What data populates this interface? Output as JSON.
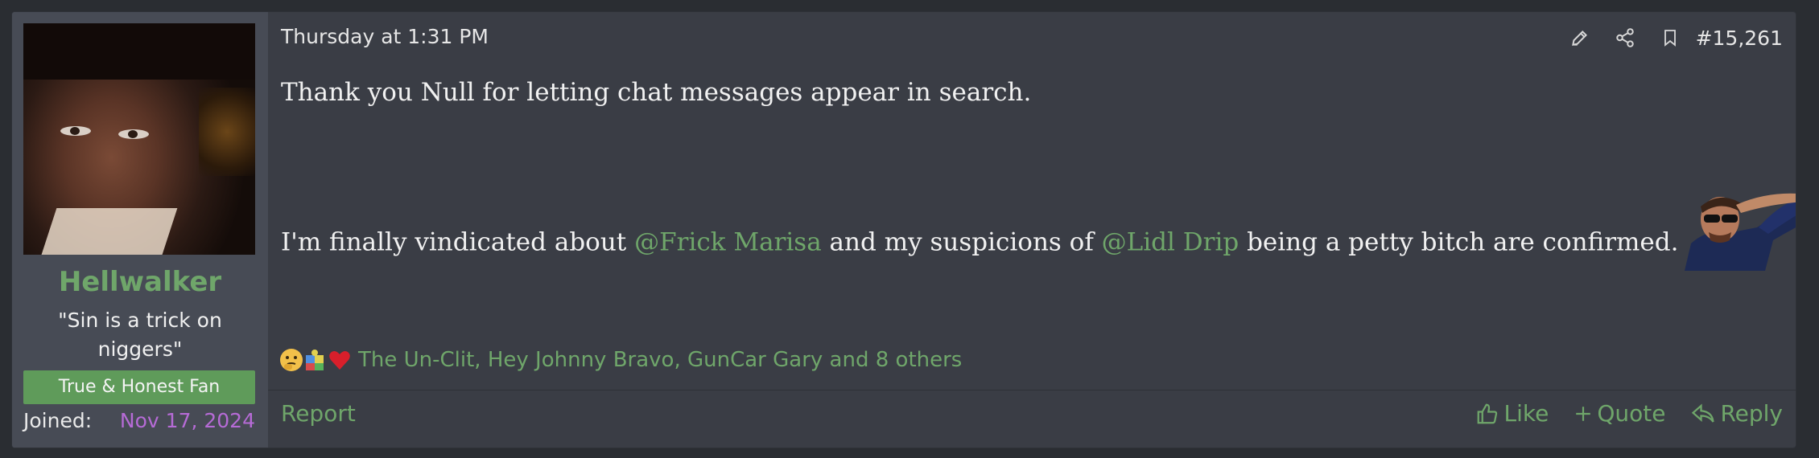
{
  "user": {
    "name": "Hellwalker",
    "title": "\"Sin is a trick on niggers\"",
    "banner": "True & Honest Fan",
    "joined_label": "Joined:",
    "joined_value": "Nov 17, 2024"
  },
  "post": {
    "timestamp": "Thursday at 1:31 PM",
    "number": "#15,261",
    "line1": "Thank you Null for letting chat messages appear in search.",
    "line2_a": "I'm finally vindicated about ",
    "mention1": "@Frick Marisa",
    "line2_b": " and my suspicions of ",
    "mention2": "@Lidl Drip",
    "line2_c": " being a petty bitch are confirmed."
  },
  "reactions": {
    "icons": [
      "thinking-face-icon",
      "puzzle-piece-icon",
      "heart-icon"
    ],
    "names": "The Un-Clit, Hey Johnny Bravo, GunCar Gary and 8 others"
  },
  "footer": {
    "report": "Report",
    "like": "Like",
    "quote": "Quote",
    "reply": "Reply"
  },
  "colors": {
    "accent": "#6fa66a",
    "joined_date": "#b66bd6",
    "panel": "#474b55",
    "post_bg": "#3a3d45"
  }
}
